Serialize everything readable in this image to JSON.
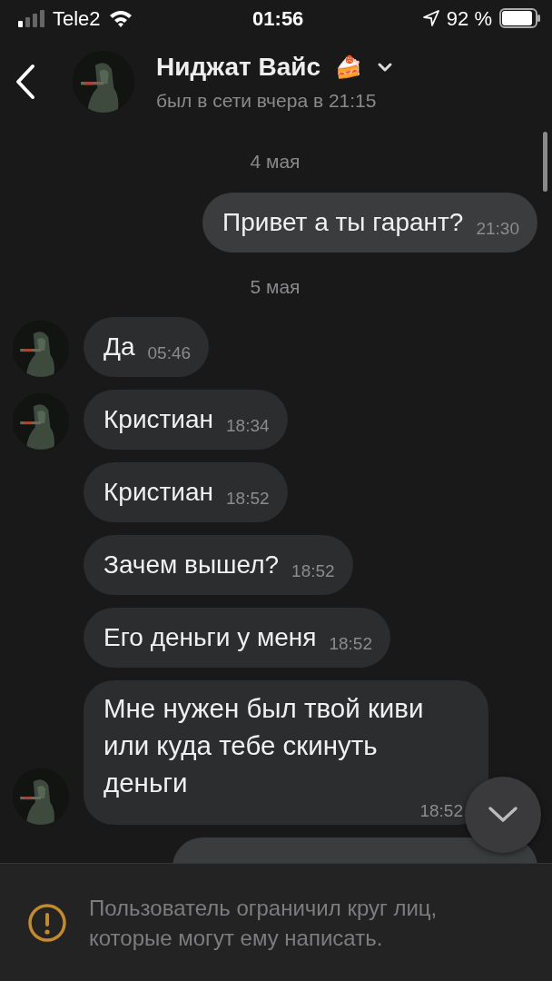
{
  "status_bar": {
    "carrier": "Tele2",
    "time": "01:56",
    "battery": "92 %"
  },
  "header": {
    "name": "Ниджат Вайс",
    "emoji": "🍰",
    "status": "был в сети вчера в 21:15"
  },
  "messages": [
    {
      "kind": "date",
      "text": "4 мая"
    },
    {
      "kind": "message",
      "outgoing": true,
      "text": "Привет а ты гарант?",
      "time": "21:30"
    },
    {
      "kind": "date",
      "text": "5 мая"
    },
    {
      "kind": "message",
      "outgoing": false,
      "text": "Да",
      "time": "05:46",
      "show_avatar": true
    },
    {
      "kind": "message",
      "outgoing": false,
      "text": "Кристиан",
      "time": "18:34",
      "show_avatar": true
    },
    {
      "kind": "message",
      "outgoing": false,
      "text": "Кристиан",
      "time": "18:52",
      "show_avatar": false
    },
    {
      "kind": "message",
      "outgoing": false,
      "text": "Зачем вышел?",
      "time": "18:52",
      "show_avatar": false
    },
    {
      "kind": "message",
      "outgoing": false,
      "text": "Его деньги у меня",
      "time": "18:52",
      "show_avatar": false
    },
    {
      "kind": "message",
      "outgoing": false,
      "text": "Мне нужен был твой киви или куда тебе скинуть деньги",
      "time": "18:52",
      "show_avatar": true
    },
    {
      "kind": "cut_bubble",
      "outgoing": true
    }
  ],
  "notice": {
    "text": "Пользователь ограничил круг лиц, которые могут ему написать."
  }
}
